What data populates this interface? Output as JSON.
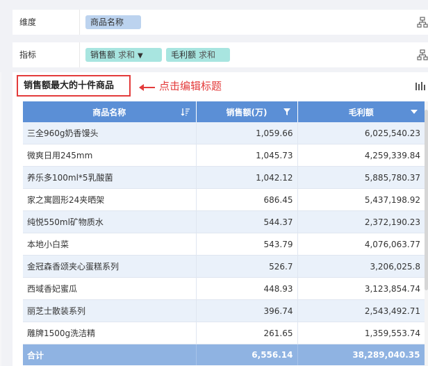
{
  "config": {
    "dimension": {
      "label": "维度",
      "fields": [
        {
          "name": "商品名称"
        }
      ]
    },
    "indicator": {
      "label": "指标",
      "fields": [
        {
          "name": "销售额",
          "agg": "求和",
          "filter_icon": "filter-icon"
        },
        {
          "name": "毛利额",
          "agg": "求和"
        }
      ]
    },
    "row_icon": "hierarchy-icon"
  },
  "widget": {
    "title": "销售额最大的十件商品",
    "annotation": "点击编辑标题",
    "annotation_color": "#e33b3b",
    "chart_icon": "chart-type-icon",
    "table": {
      "columns": [
        {
          "label": "商品名称",
          "icon": "sort-desc-icon"
        },
        {
          "label": "销售额(万)",
          "icon": "filter-icon"
        },
        {
          "label": "毛利额",
          "icon": "dropdown-triangle-icon"
        }
      ],
      "rows": [
        [
          "三全960g奶香馒头",
          "1,059.66",
          "6,025,540.23"
        ],
        [
          "微爽日用245mm",
          "1,045.73",
          "4,259,339.84"
        ],
        [
          "养乐多100ml*5乳酸菌",
          "1,042.12",
          "5,885,780.37"
        ],
        [
          "家之寓圆形24夹晒架",
          "686.45",
          "5,437,198.92"
        ],
        [
          "纯悦550ml矿物质水",
          "544.37",
          "2,372,190.23"
        ],
        [
          "本地小白菜",
          "543.79",
          "4,076,063.77"
        ],
        [
          "金冠森香颂夹心蛋糕系列",
          "526.7",
          "3,206,025.8"
        ],
        [
          "西域香妃蜜瓜",
          "448.93",
          "3,123,854.74"
        ],
        [
          "丽芝士散装系列",
          "396.74",
          "2,543,492.71"
        ],
        [
          "雕牌1500g洗洁精",
          "261.65",
          "1,359,553.74"
        ]
      ],
      "total": [
        "合计",
        "6,556.14",
        "38,289,040.35"
      ]
    },
    "colors": {
      "header_bg": "#5b8fd6",
      "total_bg": "#8fb3e2",
      "row_alt_bg": "#eaf1fa",
      "dim_pill": "#bcd3ef",
      "ind_pill": "#a8e5e0"
    }
  }
}
